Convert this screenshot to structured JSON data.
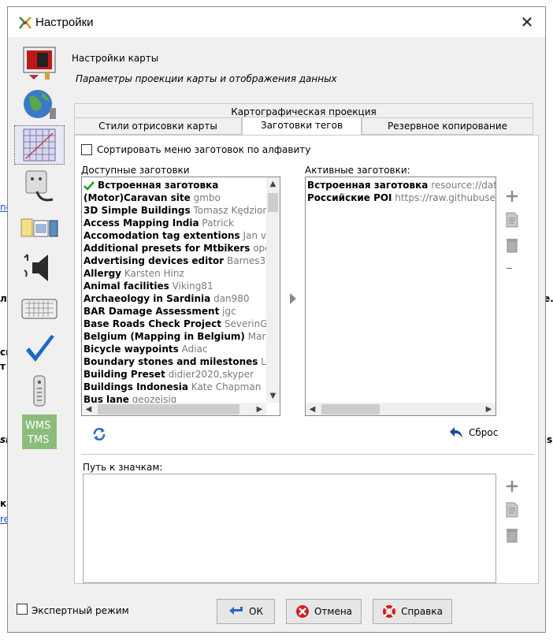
{
  "window": {
    "title": "Настройки",
    "close_symbol": "✕"
  },
  "header": {
    "title": "Настройки карты",
    "subtitle": "Параметры проекции карты и отображения данных"
  },
  "tabs": {
    "row1": [
      "Картографическая проекция"
    ],
    "row2": [
      "Стили отрисовки карты",
      "Заготовки тегов",
      "Резервное копирование"
    ],
    "active": "Заготовки тегов"
  },
  "sort_checkbox": {
    "label": "Сортировать меню заготовок по алфавиту",
    "checked": false
  },
  "available": {
    "label": "Доступные заготовки",
    "items": [
      {
        "name": "Встроенная заготовка",
        "author": "",
        "checked": true
      },
      {
        "name": "(Motor)Caravan site",
        "author": "gmbo"
      },
      {
        "name": "3D Simple Buildings",
        "author": "Tomasz Kędziora"
      },
      {
        "name": "Access Mapping India",
        "author": "Patrick"
      },
      {
        "name": "Accomodation tag extentions",
        "author": "Jan va"
      },
      {
        "name": "Additional presets for Mtbikers",
        "author": "ope"
      },
      {
        "name": "Advertising devices editor",
        "author": "Barnes38"
      },
      {
        "name": "Allergy",
        "author": "Karsten Hinz"
      },
      {
        "name": "Animal facilities",
        "author": "Viking81"
      },
      {
        "name": "Archaeology in Sardinia",
        "author": "dan980"
      },
      {
        "name": "BAR Damage Assessment",
        "author": "jgc"
      },
      {
        "name": "Base Roads Check Project",
        "author": "SeverinGe"
      },
      {
        "name": "Belgium (Mapping in Belgium)",
        "author": "Marc G"
      },
      {
        "name": "Bicycle waypoints",
        "author": "Adiac"
      },
      {
        "name": "Boundary stones and milestones",
        "author": "Lü"
      },
      {
        "name": "Building Preset",
        "author": "didier2020,skyper"
      },
      {
        "name": "Buildings Indonesia",
        "author": "Kate Chapman"
      },
      {
        "name": "Bus lane",
        "author": "geozeisig"
      }
    ]
  },
  "active": {
    "label": "Активные заготовки:",
    "items": [
      {
        "name": "Встроенная заготовка",
        "source": "resource://data"
      },
      {
        "name": "Российские POI",
        "source": "https://raw.githubuserc"
      }
    ]
  },
  "reset_label": "Сброс",
  "icons_path_label": "Путь к значкам:",
  "expert_mode": {
    "label": "Экспертный режим",
    "checked": false
  },
  "buttons": {
    "ok": "ОК",
    "cancel": "Отмена",
    "help": "Справка"
  },
  "background": {
    "frag1": "ne",
    "frag2": "ла",
    "frag3": "le.",
    "frag4": "си",
    "frag5": "т",
    "frag6": "sit",
    "frag7": "is",
    "frag8": "ка",
    "frag9": "re"
  }
}
